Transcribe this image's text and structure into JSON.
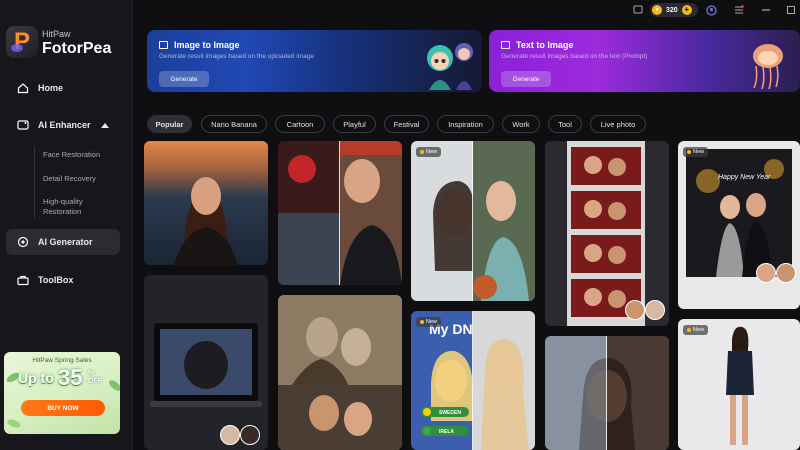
{
  "brand": {
    "company": "HitPaw",
    "product": "FotorPea"
  },
  "sidebar": {
    "home": "Home",
    "ai_enhancer": "AI Enhancer",
    "sub_items": [
      "Face Restoration",
      "Detail Recovery",
      "High-quality",
      "Restoration"
    ],
    "ai_generator": "AI Generator",
    "toolbox": "ToolBox"
  },
  "promo": {
    "title": "HitPaw Spring Sales",
    "up_to": "Up to",
    "number": "35",
    "pct": "%",
    "off": "OFF",
    "button": "BUY NOW"
  },
  "topbar": {
    "credits": "320"
  },
  "banners": [
    {
      "title": "Image to Image",
      "desc": "Generate result images based on the uploaded image",
      "button": "Generate"
    },
    {
      "title": "Text to Image",
      "desc": "Generate result images based on the text (Prompt)",
      "button": "Generate"
    }
  ],
  "categories": [
    "Popular",
    "Nano Banana",
    "Cartoon",
    "Playful",
    "Festival",
    "Inspiration",
    "Work",
    "Tool",
    "Live photo"
  ],
  "badges": {
    "new": "New"
  },
  "card_text": {
    "dny": "My DN",
    "sweden": "SWEDEN",
    "ireland": "IRELA",
    "new_year": "Happy New Year"
  },
  "colors": {
    "accent_orange": "#ff7a1a",
    "banner1": "#2148b4",
    "banner2": "#9c2bdd",
    "coin": "#f5b81f"
  }
}
